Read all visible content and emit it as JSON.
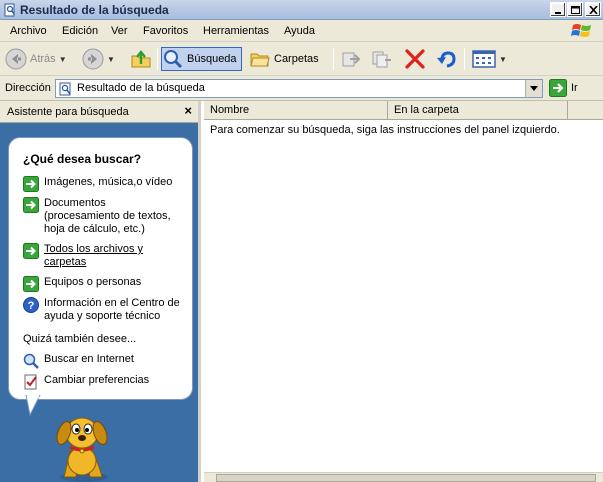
{
  "window": {
    "title": "Resultado de la búsqueda"
  },
  "menu": {
    "items": [
      "Archivo",
      "Edición",
      "Ver",
      "Favoritos",
      "Herramientas",
      "Ayuda"
    ]
  },
  "toolbar": {
    "back_label": "Atrás",
    "search_label": "Búsqueda",
    "folders_label": "Carpetas"
  },
  "address": {
    "label": "Dirección",
    "value": "Resultado de la búsqueda",
    "go_label": "Ir"
  },
  "search_pane": {
    "header": "Asistente para búsqueda",
    "close_label": "×",
    "question": "¿Qué desea buscar?",
    "options": [
      {
        "label": "Imágenes, música,o vídeo",
        "icon": "green-arrow-icon"
      },
      {
        "label": "Documentos (procesamiento de textos, hoja de cálculo, etc.)",
        "icon": "green-arrow-icon"
      },
      {
        "label": "Todos los archivos y carpetas",
        "icon": "green-arrow-icon"
      },
      {
        "label": "Equipos o personas",
        "icon": "green-arrow-icon"
      },
      {
        "label": "Información en el Centro de ayuda y soporte técnico",
        "icon": "help-icon"
      }
    ],
    "also_label": "Quizá también desee...",
    "extras": [
      {
        "label": "Buscar en Internet",
        "icon": "internet-search-icon"
      },
      {
        "label": "Cambiar preferencias",
        "icon": "preferences-icon"
      }
    ]
  },
  "results": {
    "columns": [
      "Nombre",
      "En la carpeta"
    ],
    "hint": "Para comenzar su búsqueda, siga las instrucciones del panel izquierdo."
  },
  "colors": {
    "pane_blue": "#3a6ea5",
    "chrome": "#ece9d8"
  }
}
